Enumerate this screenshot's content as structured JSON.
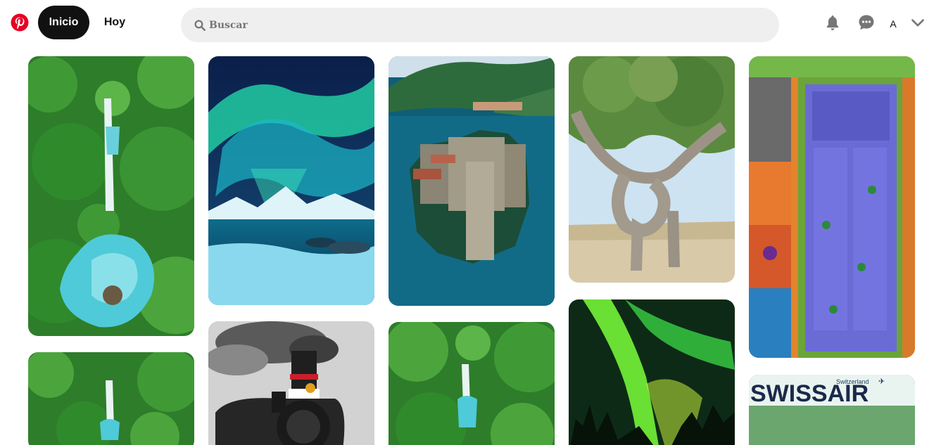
{
  "header": {
    "logo_icon": "pinterest-logo-icon",
    "home_label": "Inicio",
    "today_label": "Hoy",
    "search": {
      "placeholder": "Buscar",
      "value": ""
    },
    "notifications_icon": "bell-icon",
    "messages_icon": "chat-bubble-icon",
    "avatar_initial": "A",
    "account_menu_icon": "chevron-down-icon"
  },
  "colors": {
    "brand_red": "#e60023",
    "active_tab_bg": "#111111",
    "search_bg": "#efefef"
  },
  "pins": [
    {
      "subject": "waterfall-jungle-aerial"
    },
    {
      "subject": "aurora-over-lake"
    },
    {
      "subject": "island-castle-lake"
    },
    {
      "subject": "knotted-tree"
    },
    {
      "subject": "purple-door-colorful-wall"
    },
    {
      "subject": "waterfall-jungle-aerial"
    },
    {
      "subject": "steam-locomotive-350"
    },
    {
      "subject": "waterfall-jungle-aerial"
    },
    {
      "subject": "green-aurora-forest"
    },
    {
      "subject": "swissair-poster",
      "brand_text": "SWISSAIR",
      "country_text": "Switzerland"
    }
  ]
}
